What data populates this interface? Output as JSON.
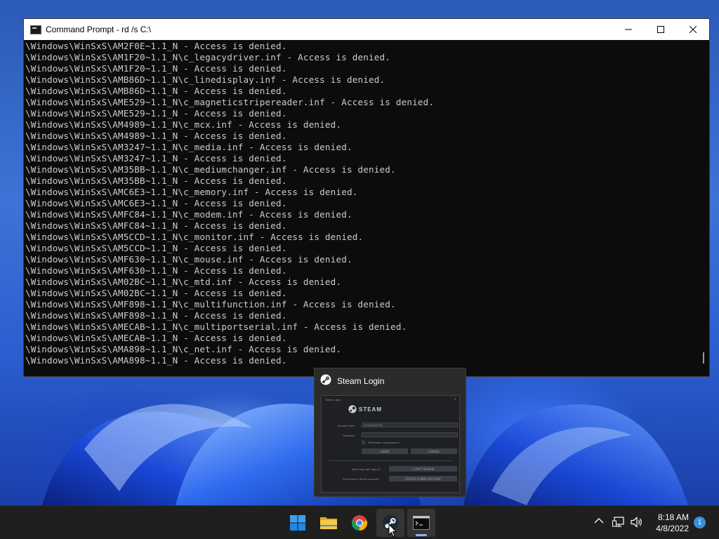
{
  "cmd": {
    "title": "Command Prompt - rd  /s C:\\",
    "lines": [
      "\\Windows\\WinSxS\\AM2F0E~1.1_N - Access is denied.",
      "\\Windows\\WinSxS\\AM1F20~1.1_N\\c_legacydriver.inf - Access is denied.",
      "\\Windows\\WinSxS\\AM1F20~1.1_N - Access is denied.",
      "\\Windows\\WinSxS\\AMB86D~1.1_N\\c_linedisplay.inf - Access is denied.",
      "\\Windows\\WinSxS\\AMB86D~1.1_N - Access is denied.",
      "\\Windows\\WinSxS\\AME529~1.1_N\\c_magneticstripereader.inf - Access is denied.",
      "\\Windows\\WinSxS\\AME529~1.1_N - Access is denied.",
      "\\Windows\\WinSxS\\AM4989~1.1_N\\c_mcx.inf - Access is denied.",
      "\\Windows\\WinSxS\\AM4989~1.1_N - Access is denied.",
      "\\Windows\\WinSxS\\AM3247~1.1_N\\c_media.inf - Access is denied.",
      "\\Windows\\WinSxS\\AM3247~1.1_N - Access is denied.",
      "\\Windows\\WinSxS\\AM35BB~1.1_N\\c_mediumchanger.inf - Access is denied.",
      "\\Windows\\WinSxS\\AM35BB~1.1_N - Access is denied.",
      "\\Windows\\WinSxS\\AMC6E3~1.1_N\\c_memory.inf - Access is denied.",
      "\\Windows\\WinSxS\\AMC6E3~1.1_N - Access is denied.",
      "\\Windows\\WinSxS\\AMFC84~1.1_N\\c_modem.inf - Access is denied.",
      "\\Windows\\WinSxS\\AMFC84~1.1_N - Access is denied.",
      "\\Windows\\WinSxS\\AM5CCD~1.1_N\\c_monitor.inf - Access is denied.",
      "\\Windows\\WinSxS\\AM5CCD~1.1_N - Access is denied.",
      "\\Windows\\WinSxS\\AMF630~1.1_N\\c_mouse.inf - Access is denied.",
      "\\Windows\\WinSxS\\AMF630~1.1_N - Access is denied.",
      "\\Windows\\WinSxS\\AM02BC~1.1_N\\c_mtd.inf - Access is denied.",
      "\\Windows\\WinSxS\\AM02BC~1.1_N - Access is denied.",
      "\\Windows\\WinSxS\\AMF898~1.1_N\\c_multifunction.inf - Access is denied.",
      "\\Windows\\WinSxS\\AMF898~1.1_N - Access is denied.",
      "\\Windows\\WinSxS\\AMECAB~1.1_N\\c_multiportserial.inf - Access is denied.",
      "\\Windows\\WinSxS\\AMECAB~1.1_N - Access is denied.",
      "\\Windows\\WinSxS\\AMA898~1.1_N\\c_net.inf - Access is denied.",
      "\\Windows\\WinSxS\\AMA898~1.1_N - Access is denied."
    ]
  },
  "steam_preview": {
    "title": "Steam Login",
    "logo_text": "STEAM",
    "window_caption": "Steam Login",
    "account_label": "Account name",
    "account_value": "computerhindi2",
    "password_label": "Password",
    "remember_label": "Remember my password",
    "login_button": "LOGIN",
    "cancel_button": "CANCEL",
    "help_label": "Need help with sign in?",
    "help_button": "I CAN'T SIGN IN",
    "create_label": "Don't have a Steam account?",
    "create_button": "CREATE A NEW ACCOUNT"
  },
  "taskbar": {
    "apps": [
      {
        "name": "start-button",
        "icon": "windows-logo-icon"
      },
      {
        "name": "file-explorer",
        "icon": "folder-icon"
      },
      {
        "name": "chrome",
        "icon": "chrome-icon"
      },
      {
        "name": "steam",
        "icon": "steam-icon"
      },
      {
        "name": "command-prompt",
        "icon": "terminal-icon"
      }
    ],
    "time": "8:18 AM",
    "date": "4/8/2022",
    "notification_count": "1"
  },
  "colors": {
    "terminal_bg": "#0c0c0c",
    "terminal_text": "#cccccc",
    "taskbar_bg": "#1f1f1f",
    "accent": "#3b8fd9"
  }
}
